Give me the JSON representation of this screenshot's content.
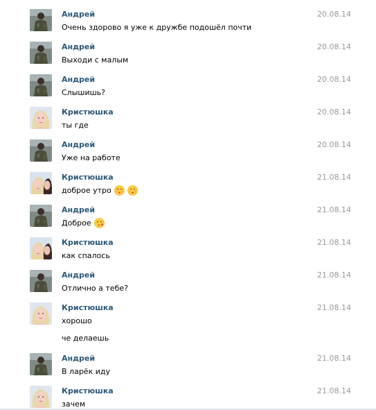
{
  "messages": [
    {
      "author": "Андрей",
      "date": "20.08.14",
      "text": "Очень здорово я уже к дружбе подошёл почти"
    },
    {
      "author": "Андрей",
      "date": "20.08.14",
      "text": "Выходи с малым"
    },
    {
      "author": "Андрей",
      "date": "20.08.14",
      "text": "Слышишь?"
    },
    {
      "author": "Кристюшка",
      "date": "20.08.14",
      "text": "ты где"
    },
    {
      "author": "Андрей",
      "date": "20.08.14",
      "text": "Уже на работе"
    },
    {
      "author": "Кристюшка",
      "date": "21.08.14",
      "text": "доброе утро",
      "emoji": [
        "kissing-face-icon",
        "kissing-face-icon"
      ]
    },
    {
      "author": "Андрей",
      "date": "21.08.14",
      "text": "Доброе",
      "emoji": [
        "face-blowing-kiss-icon"
      ]
    },
    {
      "author": "Кристюшка",
      "date": "21.08.14",
      "text": "как спалось"
    },
    {
      "author": "Андрей",
      "date": "21.08.14",
      "text": "Отлично а тебе?"
    },
    {
      "author": "Кристюшка",
      "date": "21.08.14",
      "text": "хорошо"
    },
    {
      "author": "",
      "date": "",
      "text": "че делаешь"
    },
    {
      "author": "Андрей",
      "date": "21.08.14",
      "text": "В ларёк иду"
    },
    {
      "author": "Кристюшка",
      "date": "21.08.14",
      "text": "зачем"
    }
  ],
  "colors": {
    "author": "#2b587a",
    "date": "#999999",
    "text": "#000000"
  }
}
